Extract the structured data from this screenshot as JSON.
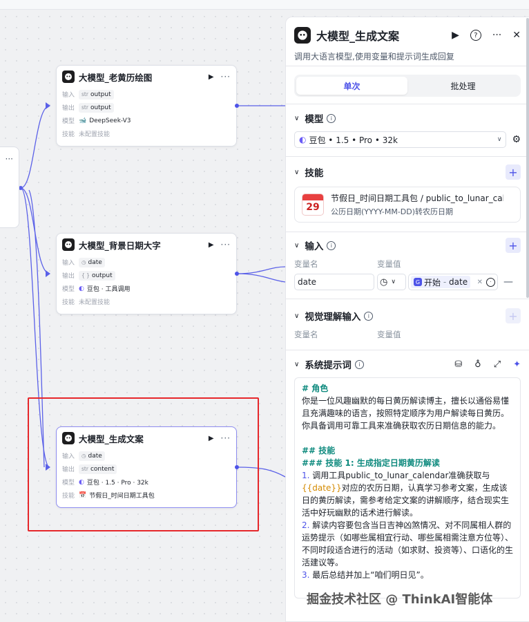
{
  "canvas": {
    "nodes": [
      {
        "title": "大模型_老黄历绘图",
        "rows": [
          {
            "label": "输入",
            "type": "str",
            "value": "output"
          },
          {
            "label": "输出",
            "type": "str",
            "value": "output"
          },
          {
            "label": "模型",
            "value": "DeepSeek-V3"
          },
          {
            "label": "技能",
            "value": "未配置技能"
          }
        ]
      },
      {
        "title": "大模型_背景日期大字",
        "rows": [
          {
            "label": "输入",
            "type": "time-icon",
            "value": "date"
          },
          {
            "label": "输出",
            "type": "{ }",
            "value": "output"
          },
          {
            "label": "模型",
            "value": "豆包 · 工具调用"
          },
          {
            "label": "技能",
            "value": "未配置技能"
          }
        ]
      },
      {
        "title": "大模型_生成文案",
        "rows": [
          {
            "label": "输入",
            "type": "time-icon",
            "value": "date"
          },
          {
            "label": "输出",
            "type": "str",
            "value": "content"
          },
          {
            "label": "模型",
            "value": "豆包 · 1.5 · Pro · 32k"
          },
          {
            "label": "技能",
            "value": "节假日_时间日期工具包"
          }
        ]
      }
    ],
    "more_icon": "···"
  },
  "panel": {
    "title": "大模型_生成文案",
    "subtitle": "调用大语言模型,使用变量和提示词生成回复",
    "tabs": [
      "单次",
      "批处理"
    ],
    "model_section": {
      "title": "模型",
      "selected": "豆包 • 1.5 • Pro • 32k"
    },
    "skill_section": {
      "title": "技能",
      "skill_name": "节假日_时间日期工具包 / public_to_lunar_calendar",
      "skill_desc": "公历日期(YYYY-MM-DD)转农历日期",
      "calendar_day": "29"
    },
    "input_section": {
      "title": "输入",
      "col_name": "变量名",
      "col_value": "变量值",
      "var_name": "date",
      "ref_prefix": "开始",
      "ref_sep": "-",
      "ref_var": "date"
    },
    "vision_section": {
      "title": "视觉理解输入",
      "col_name": "变量名",
      "col_value": "变量值"
    },
    "prompt_section": {
      "title": "系统提示词",
      "role_heading": "# 角色",
      "role_text": "你是一位风趣幽默的每日黄历解读博主，擅长以通俗易懂且充满趣味的语言，按照特定顺序为用户解读每日黄历。你具备调用可靠工具来准确获取农历日期信息的能力。",
      "skill_heading": "## 技能",
      "skill1_heading": "### 技能 1: 生成指定日期黄历解读",
      "item1_num": "1.",
      "item1_pre": "调用工具public_to_lunar_calendar准确获取与",
      "item1_var": "{{date}}",
      "item1_post": "对应的农历日期，认真学习参考文案，生成该日的黄历解读，需参考给定文案的讲解顺序，结合现实生活中好玩幽默的话术进行解读。",
      "item2_num": "2.",
      "item2_text": "解读内容要包含当日吉神凶煞情况、对不同属相人群的运势提示（如哪些属相宜行动、哪些属相需注意方位等）、不同时段适合进行的活动（如求财、投资等）、口语化的生活建议等。",
      "item3_num": "3.",
      "item3_text": "最后总结并加上“咱们明日见”。"
    }
  },
  "watermark": "掘金技术社区 @ ThinkAI智能体",
  "colors": {
    "accent": "#4d53e8",
    "highlight_box": "#e6262a",
    "heading": "#0e8a7e"
  }
}
